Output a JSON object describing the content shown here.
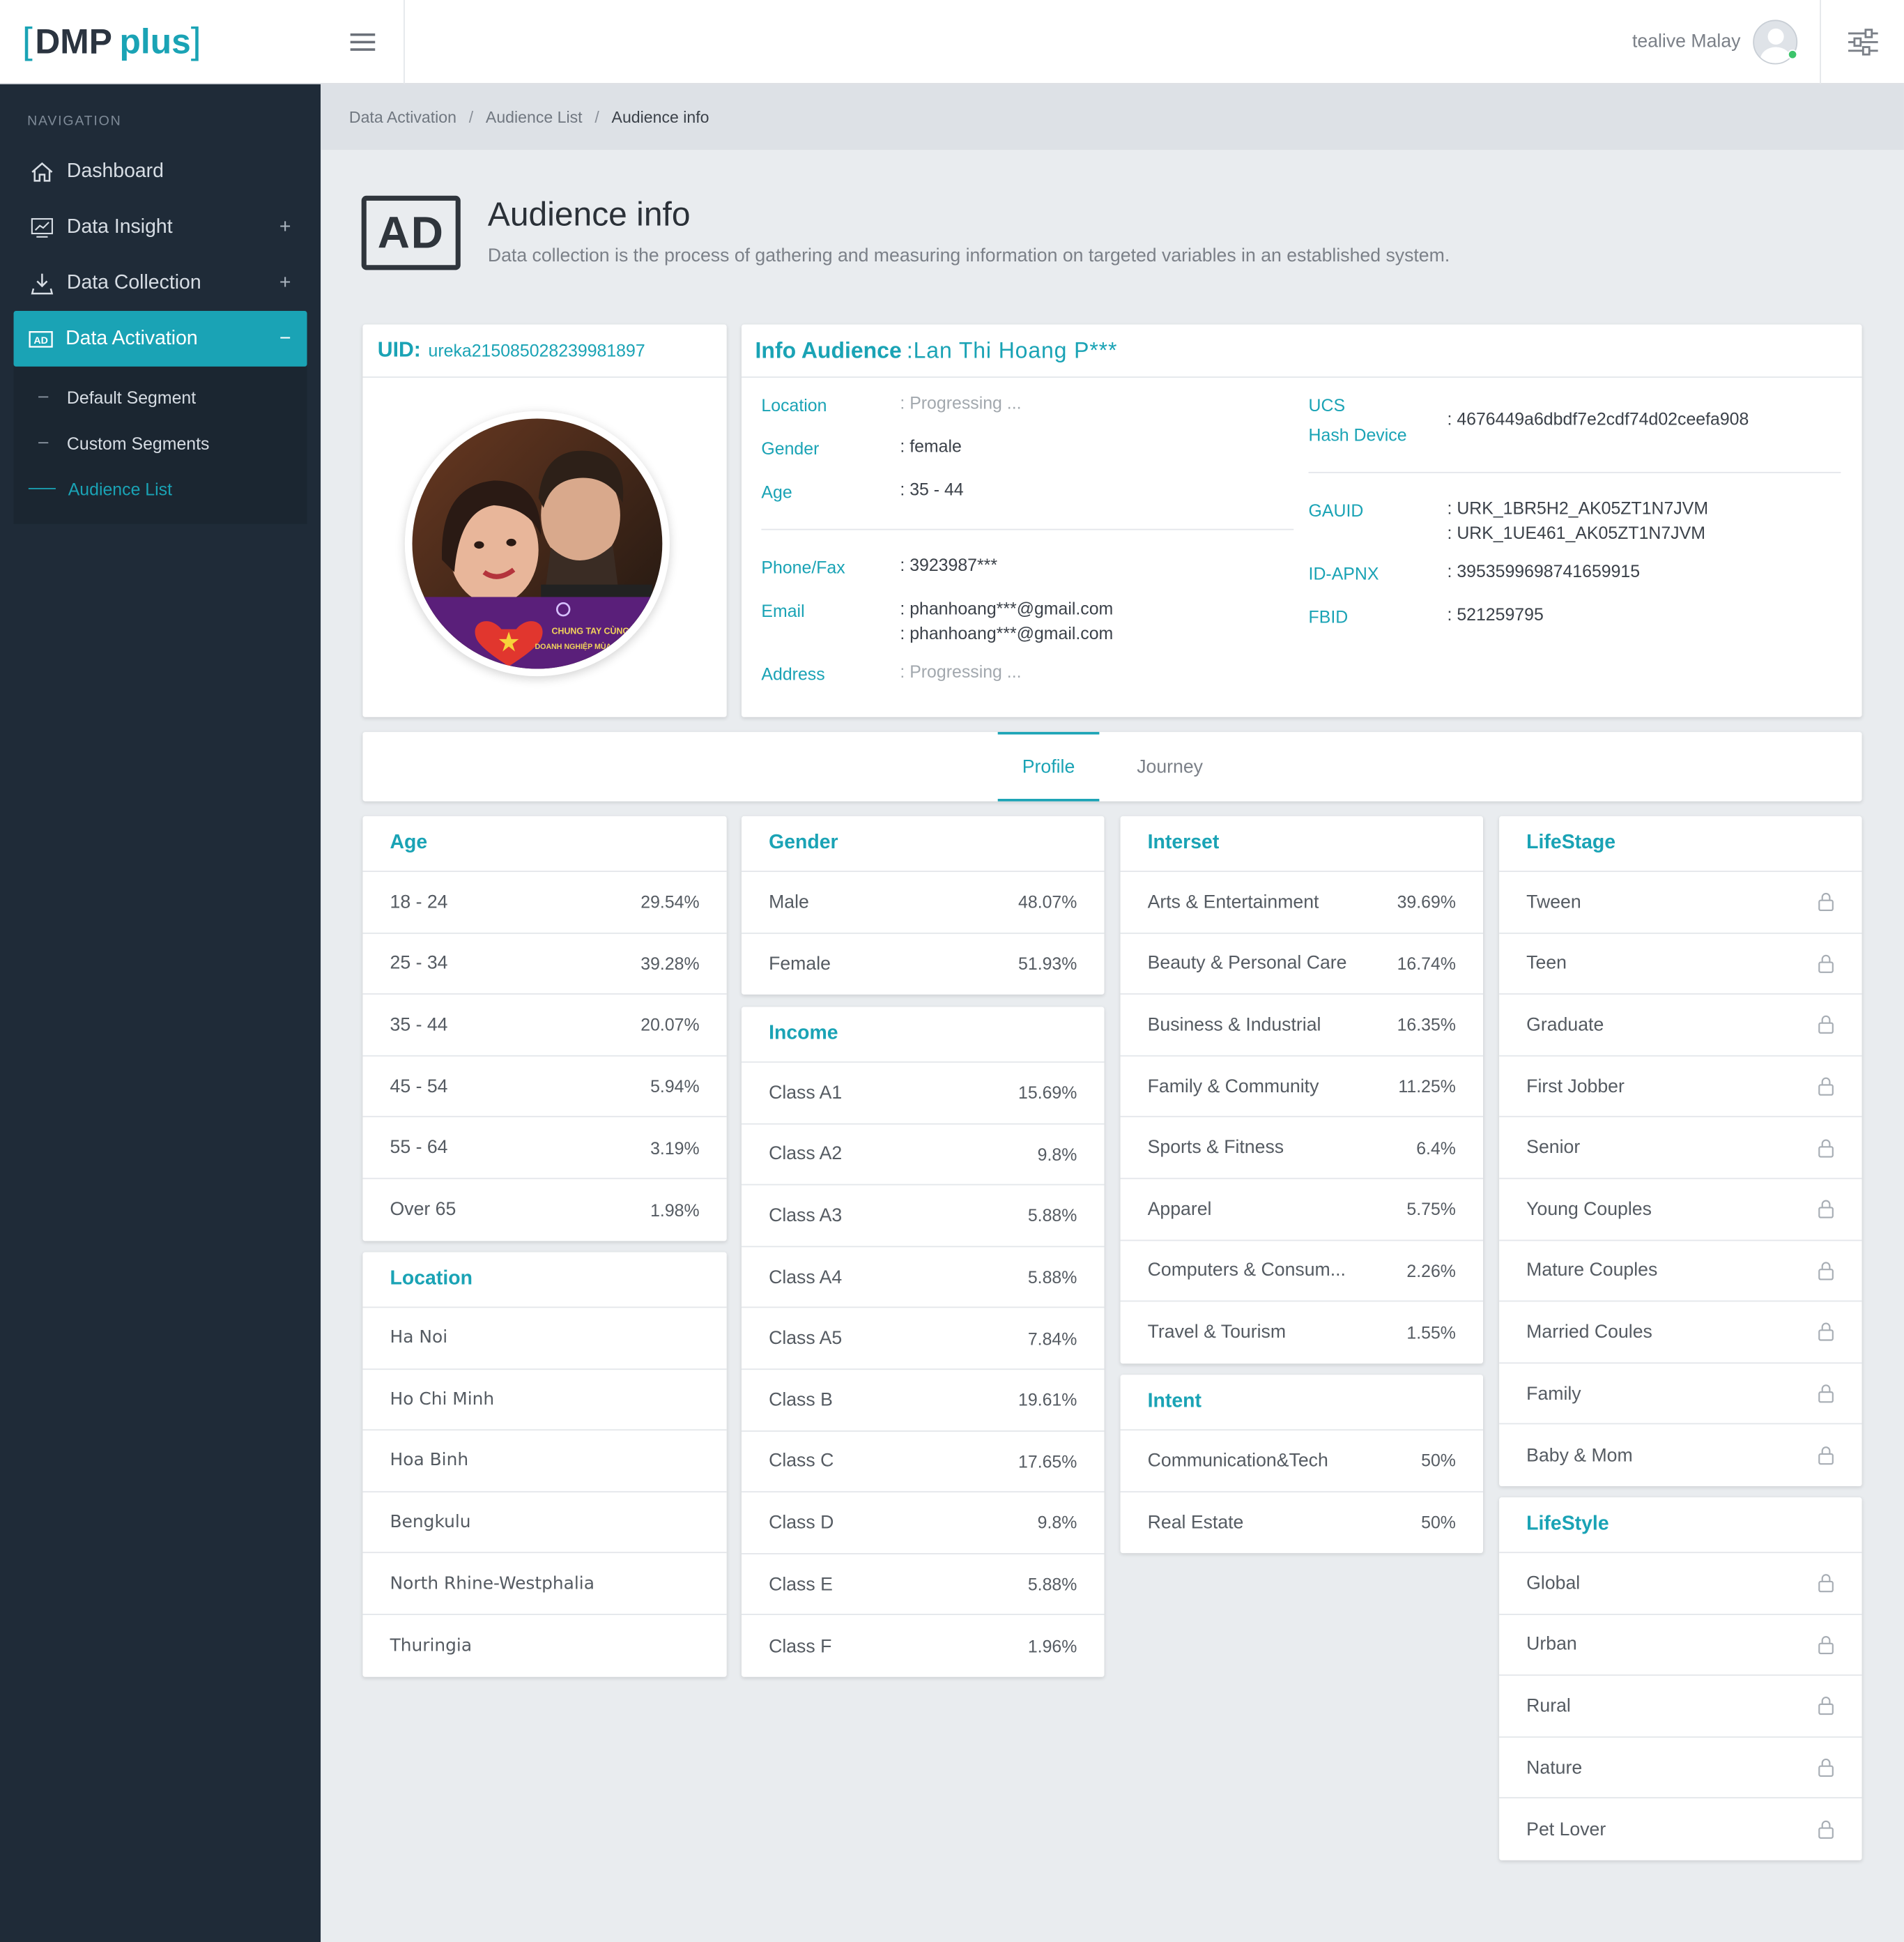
{
  "app": {
    "logo_bracket_left": "[",
    "logo_dmp": "DMP",
    "logo_plus": "plus",
    "logo_bracket_right": "]"
  },
  "topbar": {
    "user_name": "tealive Malay"
  },
  "nav": {
    "heading": "NAVIGATION",
    "items": [
      {
        "label": "Dashboard",
        "icon": "home-icon"
      },
      {
        "label": "Data Insight",
        "icon": "chart-icon",
        "toggle": "+"
      },
      {
        "label": "Data Collection",
        "icon": "download-icon",
        "toggle": "+"
      },
      {
        "label": "Data Activation",
        "icon": "ad-icon",
        "toggle": "−"
      }
    ],
    "sub_items": [
      {
        "label": "Default Segment"
      },
      {
        "label": "Custom Segments"
      },
      {
        "label": "Audience List"
      }
    ]
  },
  "breadcrumb": {
    "items": [
      "Data Activation",
      "Audience List",
      "Audience info"
    ],
    "sep": "/"
  },
  "page": {
    "badge": "AD",
    "title": "Audience info",
    "description": "Data collection is the process of gathering and measuring information on targeted variables in an established system."
  },
  "uid_card": {
    "label": "UID:",
    "value": "ureka215085028239981897",
    "photo_caption_line1": "CHUNG TAY CÙNG",
    "photo_caption_line2": "DOANH NGHIỆP MÙA CORONA"
  },
  "info_card": {
    "title": "Info Audience",
    "name": ":Lan Thi Hoang P***",
    "left": {
      "location_key": "Location",
      "location_val": ": Progressing ...",
      "gender_key": "Gender",
      "gender_val": ": female",
      "age_key": "Age",
      "age_val": ": 35 - 44",
      "phone_key": "Phone/Fax",
      "phone_val": ": 3923987***",
      "email_key": "Email",
      "email_val_1": ": phanhoang***@gmail.com",
      "email_val_2": ": phanhoang***@gmail.com",
      "address_key": "Address",
      "address_val": ": Progressing ..."
    },
    "right": {
      "ucs_key_1": "UCS",
      "ucs_key_2": "Hash Device",
      "ucs_val": ": 4676449a6dbdf7e2cdf74d02ceefa908",
      "gauid_key": "GAUID",
      "gauid_val_1": ": URK_1BR5H2_AK05ZT1N7JVM",
      "gauid_val_2": ": URK_1UE461_AK05ZT1N7JVM",
      "apnx_key": "ID-APNX",
      "apnx_val": ": 3953599698741659915",
      "fbid_key": "FBID",
      "fbid_val": ": 521259795"
    }
  },
  "tabs": [
    "Profile",
    "Journey"
  ],
  "age": {
    "title": "Age",
    "rows": [
      {
        "k": "18 - 24",
        "v": "29.54%"
      },
      {
        "k": "25 - 34",
        "v": "39.28%"
      },
      {
        "k": "35 - 44",
        "v": "20.07%"
      },
      {
        "k": "45 - 54",
        "v": "5.94%"
      },
      {
        "k": "55 - 64",
        "v": "3.19%"
      },
      {
        "k": "Over 65",
        "v": "1.98%"
      }
    ]
  },
  "location": {
    "title": "Location",
    "rows": [
      {
        "k": "Ha Noi"
      },
      {
        "k": "Ho Chi Minh"
      },
      {
        "k": "Hoa Binh"
      },
      {
        "k": "Bengkulu"
      },
      {
        "k": "North Rhine-Westphalia"
      },
      {
        "k": "Thuringia"
      }
    ]
  },
  "gender": {
    "title": "Gender",
    "rows": [
      {
        "k": "Male",
        "v": "48.07%"
      },
      {
        "k": "Female",
        "v": "51.93%"
      }
    ]
  },
  "income": {
    "title": "Income",
    "rows": [
      {
        "k": "Class A1",
        "v": "15.69%"
      },
      {
        "k": "Class A2",
        "v": "9.8%"
      },
      {
        "k": "Class A3",
        "v": "5.88%"
      },
      {
        "k": "Class A4",
        "v": "5.88%"
      },
      {
        "k": "Class A5",
        "v": "7.84%"
      },
      {
        "k": "Class B",
        "v": "19.61%"
      },
      {
        "k": "Class C",
        "v": "17.65%"
      },
      {
        "k": "Class D",
        "v": "9.8%"
      },
      {
        "k": "Class E",
        "v": "5.88%"
      },
      {
        "k": "Class F",
        "v": "1.96%"
      }
    ]
  },
  "interest": {
    "title": "Interset",
    "rows": [
      {
        "k": "Arts & Entertainment",
        "v": "39.69%"
      },
      {
        "k": "Beauty & Personal Care",
        "v": "16.74%"
      },
      {
        "k": "Business & Industrial",
        "v": "16.35%"
      },
      {
        "k": "Family & Community",
        "v": "11.25%"
      },
      {
        "k": "Sports & Fitness",
        "v": "6.4%"
      },
      {
        "k": "Apparel",
        "v": "5.75%"
      },
      {
        "k": "Computers & Consum...",
        "v": "2.26%"
      },
      {
        "k": "Travel & Tourism",
        "v": "1.55%"
      }
    ]
  },
  "intent": {
    "title": "Intent",
    "rows": [
      {
        "k": "Communication&Tech",
        "v": "50%"
      },
      {
        "k": "Real Estate",
        "v": "50%"
      }
    ]
  },
  "lifestage": {
    "title": "LifeStage",
    "rows": [
      {
        "k": "Tween"
      },
      {
        "k": "Teen"
      },
      {
        "k": "Graduate"
      },
      {
        "k": "First Jobber"
      },
      {
        "k": "Senior"
      },
      {
        "k": "Young Couples"
      },
      {
        "k": "Mature Couples"
      },
      {
        "k": "Married Coules"
      },
      {
        "k": "Family"
      },
      {
        "k": "Baby & Mom"
      }
    ]
  },
  "lifestyle": {
    "title": "LifeStyle",
    "rows": [
      {
        "k": "Global"
      },
      {
        "k": "Urban"
      },
      {
        "k": "Rural"
      },
      {
        "k": "Nature"
      },
      {
        "k": "Pet Lover"
      }
    ]
  },
  "colors": {
    "accent": "#1aa3b5",
    "sidebar": "#1f2b38",
    "background": "#e9ecef"
  }
}
